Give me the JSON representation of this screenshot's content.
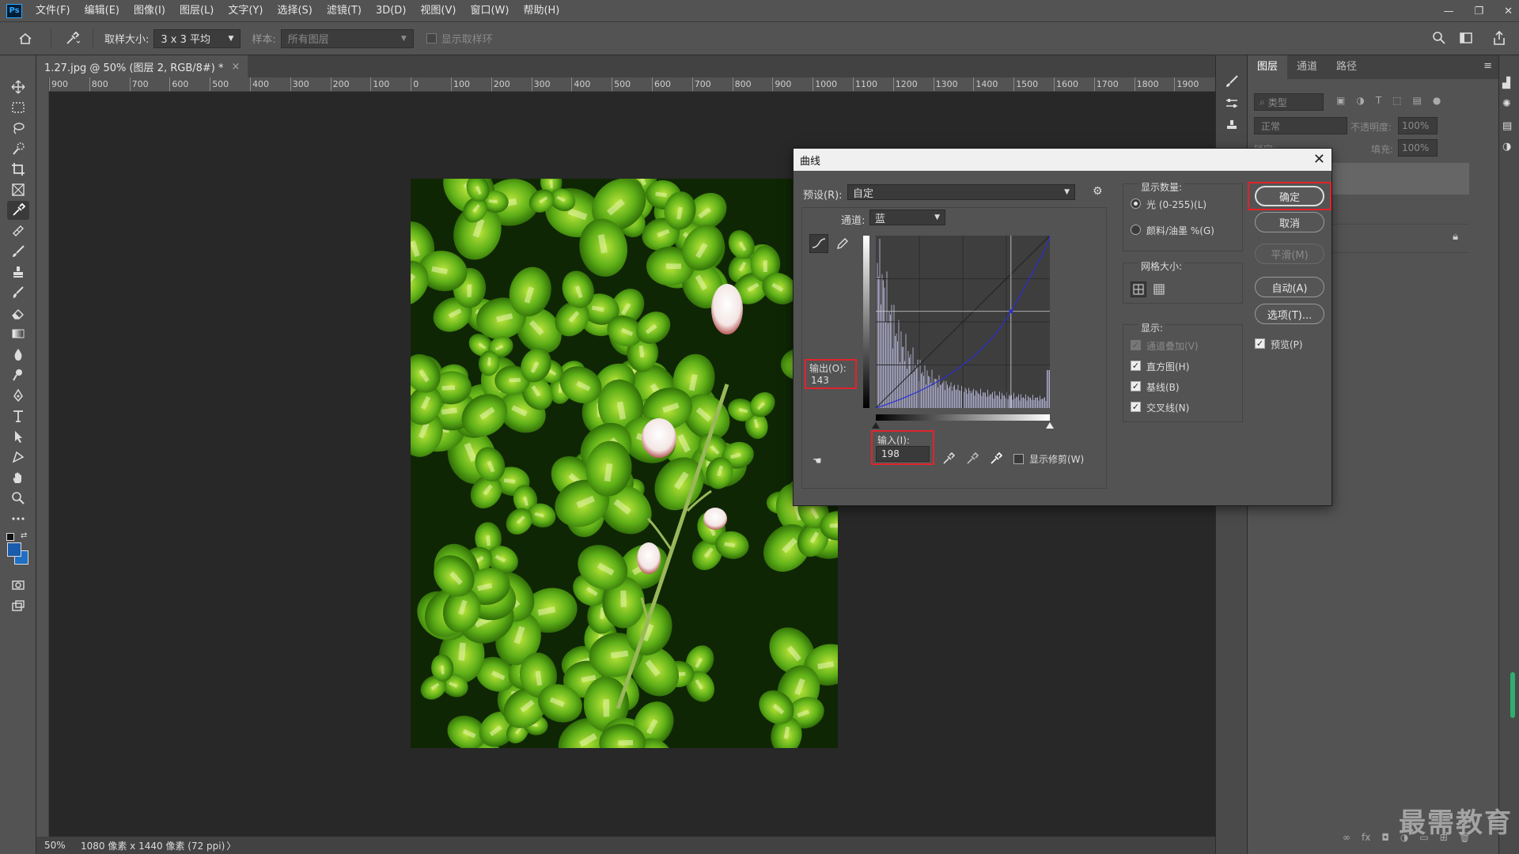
{
  "menu": {
    "items": [
      "文件(F)",
      "编辑(E)",
      "图像(I)",
      "图层(L)",
      "文字(Y)",
      "选择(S)",
      "滤镜(T)",
      "3D(D)",
      "视图(V)",
      "窗口(W)",
      "帮助(H)"
    ]
  },
  "window_controls": {
    "minimize": "—",
    "restore": "❐",
    "close": "✕"
  },
  "options": {
    "sample_size_label": "取样大小:",
    "sample_size_value": "3 x 3 平均",
    "sample_label": "样本:",
    "sample_value": "所有图层",
    "show_ring_label": "显示取样环"
  },
  "document": {
    "tab_title": "1.27.jpg @ 50% (图层 2, RGB/8#) *",
    "tab_close": "×"
  },
  "ruler": {
    "labels": [
      "900",
      "800",
      "700",
      "600",
      "500",
      "400",
      "300",
      "200",
      "100",
      "0",
      "100",
      "200",
      "300",
      "400",
      "500",
      "600",
      "700",
      "800",
      "900",
      "1000",
      "1100",
      "1200",
      "1300",
      "1400",
      "1500",
      "1600",
      "1700",
      "1800",
      "1900"
    ]
  },
  "status": {
    "zoom": "50%",
    "info": "1080 像素 x 1440 像素 (72 ppi)",
    "arrow": "〉"
  },
  "layers_panel": {
    "tabs": [
      "图层",
      "通道",
      "路径"
    ],
    "filter_label": "类型",
    "blend_mode": "正常",
    "opacity_label": "不透明度:",
    "opacity_value": "100%",
    "lock_label": "锁定:",
    "fill_label": "填充:",
    "fill_value": "100%"
  },
  "watermark": "最需教育",
  "dialog": {
    "title": "曲线",
    "close": "✕",
    "preset_label": "预设(R):",
    "preset_value": "自定",
    "channel_label": "通道:",
    "channel_value": "蓝",
    "output_label": "输出(O):",
    "output_value": "143",
    "input_label": "输入(I):",
    "input_value": "198",
    "show_clipping_label": "显示修剪(W)",
    "display_amount_title": "显示数量:",
    "light_option": "光 (0-255)(L)",
    "pigment_option": "颜料/油墨 %(G)",
    "grid_size_title": "网格大小:",
    "show_title": "显示:",
    "show_options": [
      {
        "label": "通道叠加(V)",
        "state": "disabled"
      },
      {
        "label": "直方图(H)",
        "state": "checked"
      },
      {
        "label": "基线(B)",
        "state": "checked"
      },
      {
        "label": "交叉线(N)",
        "state": "checked"
      }
    ],
    "buttons": {
      "ok": "确定",
      "cancel": "取消",
      "smooth": "平滑(M)",
      "auto": "自动(A)",
      "options": "选项(T)..."
    },
    "preview_label": "预览(P)",
    "curve_point": {
      "input": 198,
      "output": 143
    },
    "curve_color": "#2a2fd6",
    "highlight_color": "#e0242c"
  }
}
